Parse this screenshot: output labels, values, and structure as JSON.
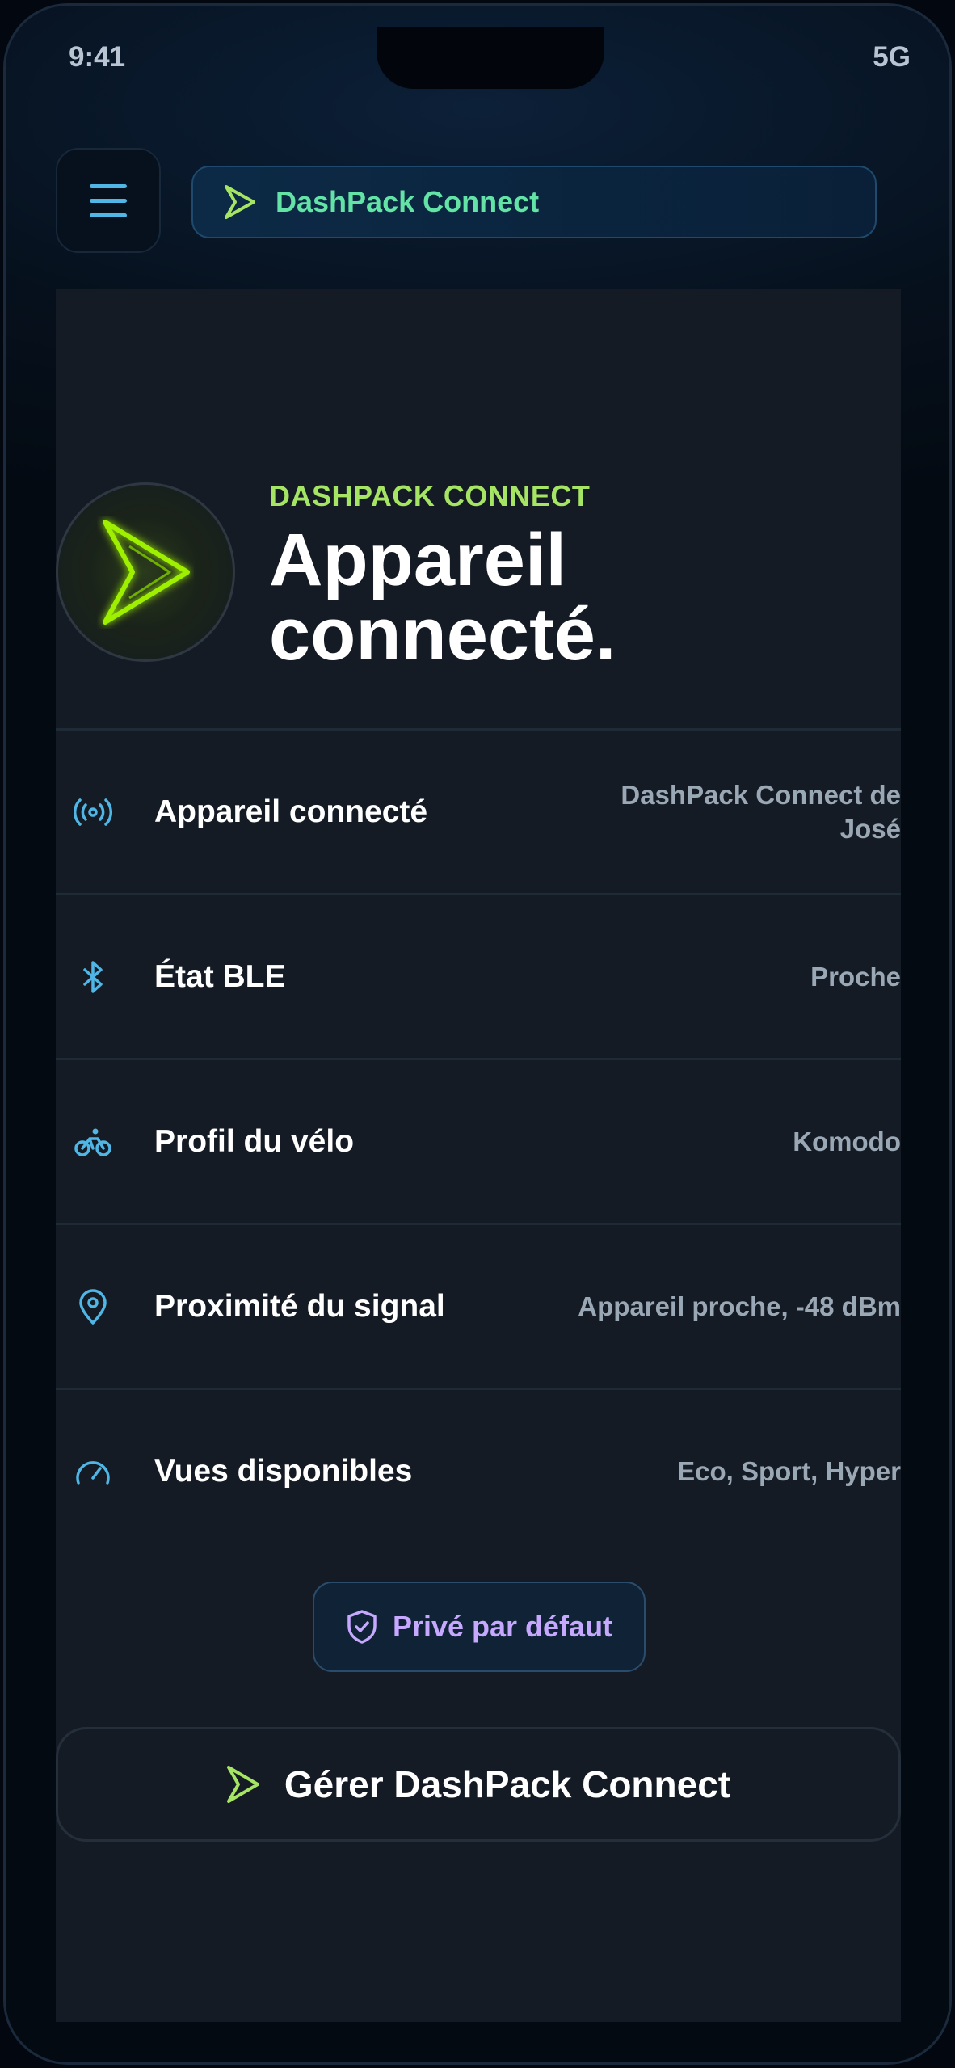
{
  "status_bar": {
    "time": "9:41",
    "network": "5G"
  },
  "header": {
    "title": "DashPack Connect"
  },
  "hero": {
    "eyebrow": "DASHPACK CONNECT",
    "title": "Appareil connecté."
  },
  "rows": [
    {
      "icon": "broadcast-icon",
      "label": "Appareil connecté",
      "value": "DashPack Connect de José"
    },
    {
      "icon": "bluetooth-icon",
      "label": "État BLE",
      "value": "Proche"
    },
    {
      "icon": "bicycle-icon",
      "label": "Profil du vélo",
      "value": "Komodo"
    },
    {
      "icon": "location-pin-icon",
      "label": "Proximité du signal",
      "value": "Appareil proche, -48 dBm"
    },
    {
      "icon": "speedometer-icon",
      "label": "Vues disponibles",
      "value": "Eco, Sport, Hyper"
    }
  ],
  "privacy_badge": {
    "icon": "shield-check-icon",
    "label": "Privé par défaut"
  },
  "manage_button": {
    "icon": "chevron-arrow-icon",
    "label": "Gérer DashPack Connect"
  },
  "colors": {
    "accent_green": "#A6E463",
    "accent_mint": "#63E3A6",
    "accent_blue": "#4FB6E6",
    "accent_purple": "#C7A8FF",
    "card_bg": "#141B24"
  }
}
